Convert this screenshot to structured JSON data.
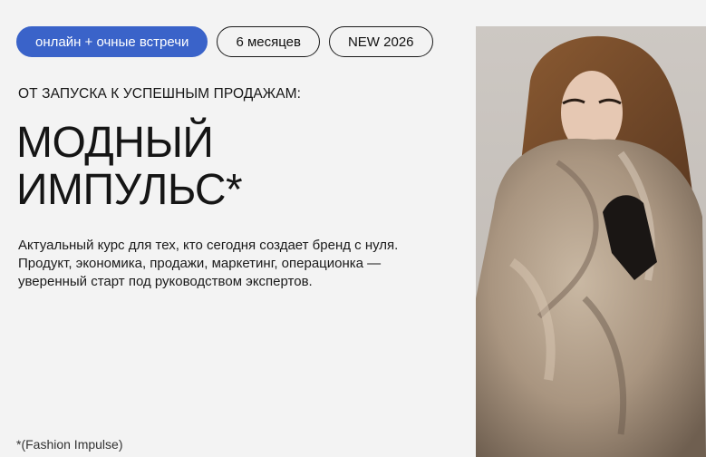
{
  "tags": [
    {
      "label": "онлайн + очные встречи"
    },
    {
      "label": "6 месяцев"
    },
    {
      "label": "NEW 2026"
    }
  ],
  "eyebrow": "ОТ ЗАПУСКА К УСПЕШНЫМ ПРОДАЖАМ:",
  "title": {
    "line1": "МОДНЫЙ",
    "line2": "ИМПУЛЬС*"
  },
  "description": {
    "line1": "Актуальный курс для тех, кто сегодня создает бренд с нуля.",
    "line2": "Продукт, экономика, продажи, маркетинг, операционка —",
    "line3": "уверенный старт под руководством экспертов."
  },
  "footnote": "*(Fashion Impulse)",
  "colors": {
    "accent": "#3a63c9",
    "background": "#f3f3f3",
    "text": "#141414"
  }
}
